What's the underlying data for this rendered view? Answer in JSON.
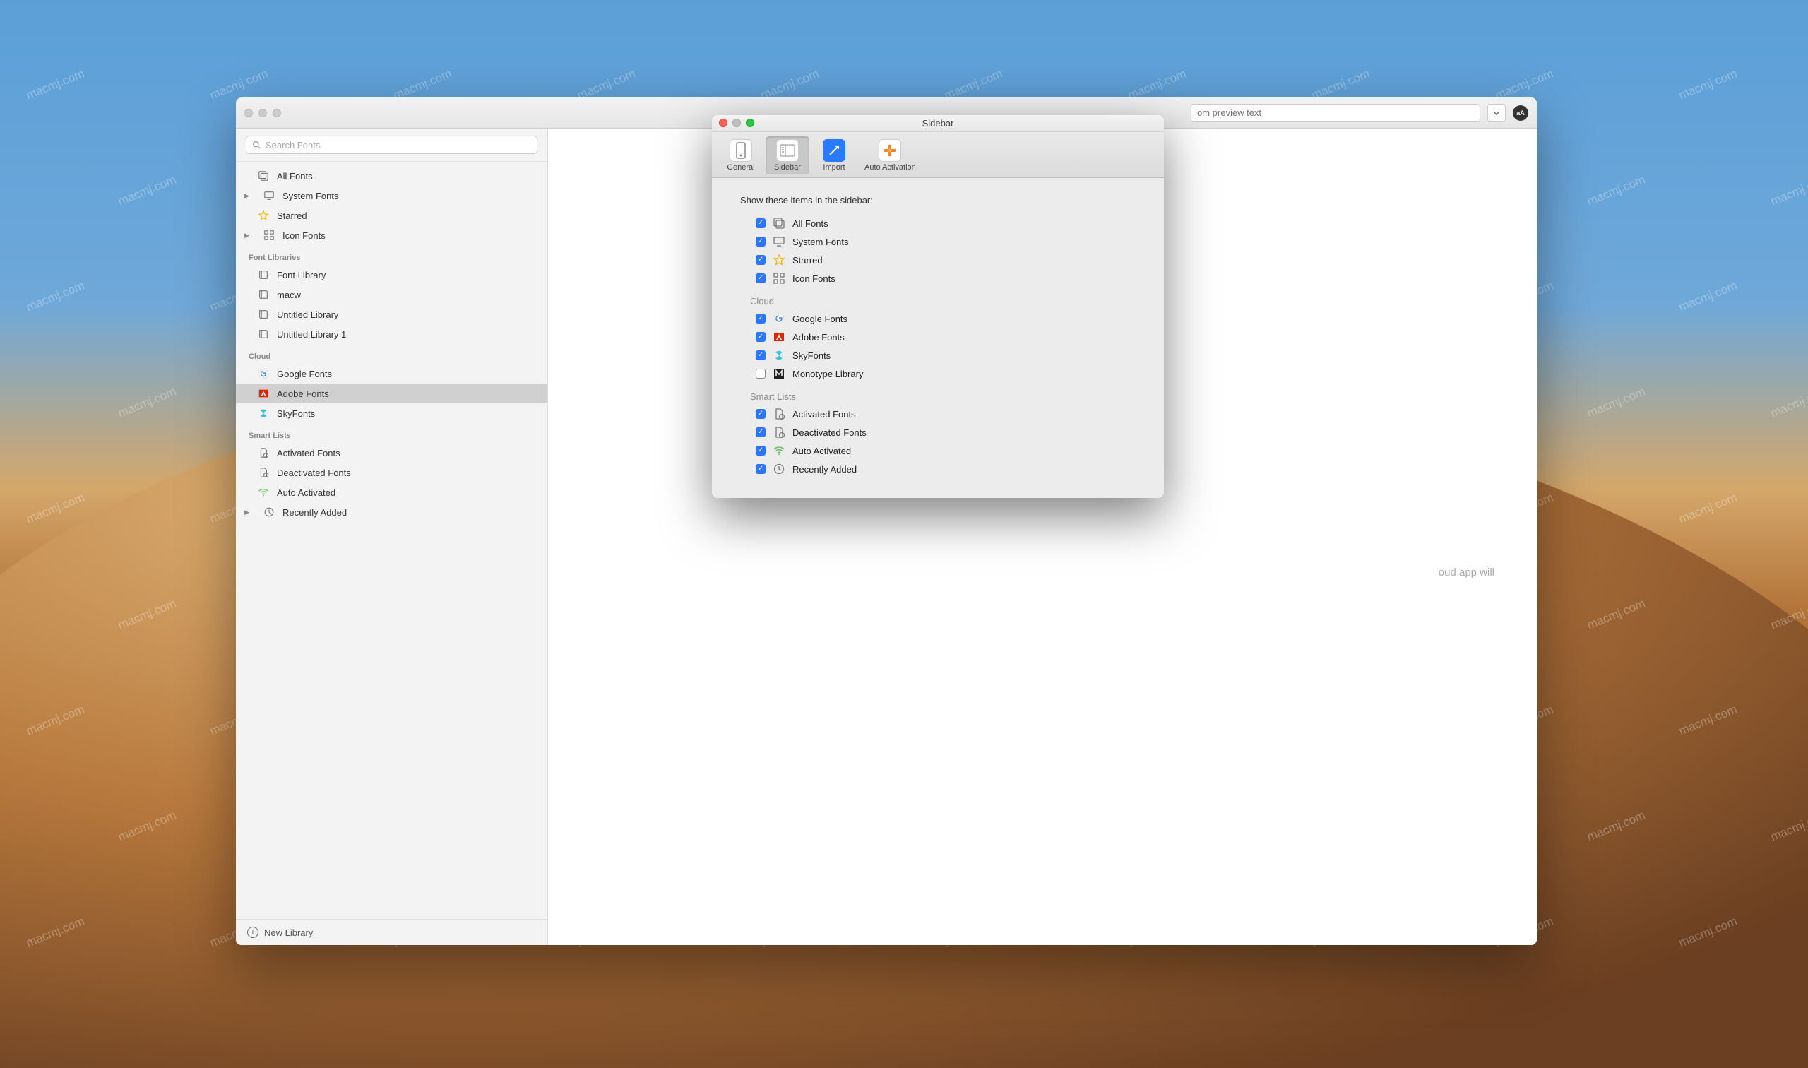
{
  "watermark_text": "macmj.com",
  "window": {
    "search_placeholder": "Search Fonts",
    "preview_placeholder": "om preview text",
    "avatar": "aA",
    "sidebar": {
      "top": [
        {
          "label": "All Fonts",
          "icon": "collection"
        },
        {
          "label": "System Fonts",
          "icon": "monitor",
          "disclosure": true
        },
        {
          "label": "Starred",
          "icon": "star"
        },
        {
          "label": "Icon Fonts",
          "icon": "grid",
          "disclosure": true
        }
      ],
      "libraries_header": "Font Libraries",
      "libraries": [
        {
          "label": "Font Library",
          "icon": "book"
        },
        {
          "label": "macw",
          "icon": "book"
        },
        {
          "label": "Untitled Library",
          "icon": "book"
        },
        {
          "label": "Untitled Library 1",
          "icon": "book"
        }
      ],
      "cloud_header": "Cloud",
      "cloud": [
        {
          "label": "Google Fonts",
          "icon": "google"
        },
        {
          "label": "Adobe Fonts",
          "icon": "adobe",
          "selected": true
        },
        {
          "label": "SkyFonts",
          "icon": "skyfonts"
        }
      ],
      "smart_header": "Smart Lists",
      "smart": [
        {
          "label": "Activated Fonts",
          "icon": "doc"
        },
        {
          "label": "Deactivated Fonts",
          "icon": "doc"
        },
        {
          "label": "Auto Activated",
          "icon": "wifi"
        },
        {
          "label": "Recently Added",
          "icon": "clock",
          "disclosure": true
        }
      ],
      "footer": "New Library"
    },
    "main_hint": "oud app will"
  },
  "pref": {
    "title": "Sidebar",
    "tabs": {
      "general": "General",
      "sidebar": "Sidebar",
      "import": "Import",
      "auto": "Auto Activation"
    },
    "heading": "Show these items in the sidebar:",
    "top_items": [
      {
        "label": "All Fonts",
        "checked": true,
        "icon": "collection"
      },
      {
        "label": "System Fonts",
        "checked": true,
        "icon": "monitor"
      },
      {
        "label": "Starred",
        "checked": true,
        "icon": "star"
      },
      {
        "label": "Icon Fonts",
        "checked": true,
        "icon": "grid"
      }
    ],
    "cloud_header": "Cloud",
    "cloud_items": [
      {
        "label": "Google Fonts",
        "checked": true,
        "icon": "google"
      },
      {
        "label": "Adobe Fonts",
        "checked": true,
        "icon": "adobe"
      },
      {
        "label": "SkyFonts",
        "checked": true,
        "icon": "skyfonts"
      },
      {
        "label": "Monotype Library",
        "checked": false,
        "icon": "monotype"
      }
    ],
    "smart_header": "Smart Lists",
    "smart_items": [
      {
        "label": "Activated Fonts",
        "checked": true,
        "icon": "doc"
      },
      {
        "label": "Deactivated Fonts",
        "checked": true,
        "icon": "doc"
      },
      {
        "label": "Auto Activated",
        "checked": true,
        "icon": "wifi"
      },
      {
        "label": "Recently Added",
        "checked": true,
        "icon": "clock"
      }
    ]
  },
  "icon_colors": {
    "star": "#f5b400",
    "google": "#4285f4",
    "adobe": "#e62200",
    "skyfonts": "#3bc1d8",
    "wifi": "#67c05a"
  }
}
